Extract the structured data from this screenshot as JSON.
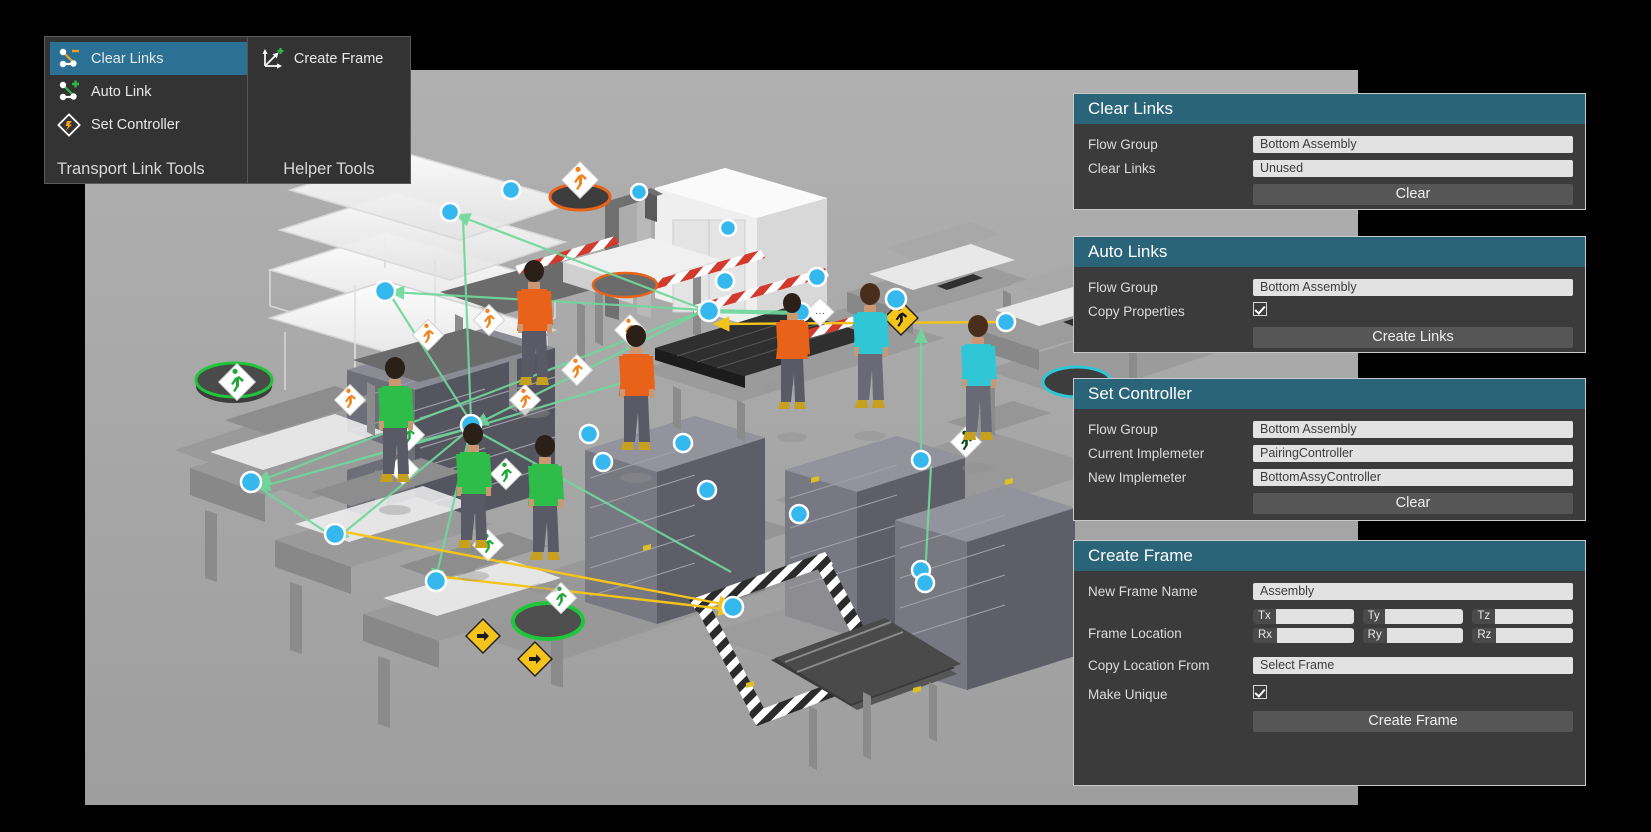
{
  "ribbon": {
    "groups": [
      {
        "name": "transport-link-tools",
        "title": "Transport Link Tools",
        "items": [
          {
            "label": "Clear Links",
            "icon": "clear-links-icon",
            "selected": true
          },
          {
            "label": "Auto Link",
            "icon": "auto-link-icon",
            "selected": false
          },
          {
            "label": "Set Controller",
            "icon": "set-controller-icon",
            "selected": false
          }
        ]
      },
      {
        "name": "helper-tools",
        "title": "Helper Tools",
        "items": [
          {
            "label": "Create Frame",
            "icon": "create-frame-icon",
            "selected": false
          }
        ]
      }
    ]
  },
  "panels": {
    "clear_links": {
      "title": "Clear Links",
      "flow_group_label": "Flow Group",
      "flow_group_value": "Bottom Assembly",
      "clear_links_label": "Clear Links",
      "clear_links_value": "Unused",
      "button_label": "Clear"
    },
    "auto_links": {
      "title": "Auto Links",
      "flow_group_label": "Flow Group",
      "flow_group_value": "Bottom Assembly",
      "copy_properties_label": "Copy Properties",
      "copy_properties_checked": "checked",
      "button_label": "Create Links"
    },
    "set_controller": {
      "title": "Set Controller",
      "flow_group_label": "Flow Group",
      "flow_group_value": "Bottom Assembly",
      "current_label": "Current Implemeter",
      "current_value": "PairingController",
      "new_label": "New Implemeter",
      "new_value": "BottomAssyController",
      "button_label": "Clear"
    },
    "create_frame": {
      "title": "Create Frame",
      "new_frame_name_label": "New Frame Name",
      "new_frame_name_value": "Assembly",
      "frame_location_label": "Frame Location",
      "tx_label": "Tx",
      "tx_value": "",
      "ty_label": "Ty",
      "ty_value": "",
      "tz_label": "Tz",
      "tz_value": "",
      "rx_label": "Rx",
      "rx_value": "",
      "ry_label": "Ry",
      "ry_value": "",
      "rz_label": "Rz",
      "rz_value": "",
      "copy_location_label": "Copy Location From",
      "copy_location_value": "Select Frame",
      "make_unique_label": "Make Unique",
      "make_unique_checked": "checked",
      "button_label": "Create Frame"
    }
  },
  "colors": {
    "header_teal": "#2a6478",
    "selected_blue": "#2a7195",
    "panel_body": "#3b3b3b",
    "viewport_gray": "#a9a9a9",
    "link_green": "#7ddca4",
    "link_yellow": "#f5c518",
    "node_cyan": "#35b8ee",
    "worker_orange": "#e8621a",
    "worker_green": "#2fbd4a",
    "worker_teal": "#2fc6d6"
  },
  "scene": {
    "name": "factory-assembly-3d-view",
    "description": "Isometric 3D factory layout with workstations, shelving racks, conveyor and human operators connected by transport links"
  }
}
